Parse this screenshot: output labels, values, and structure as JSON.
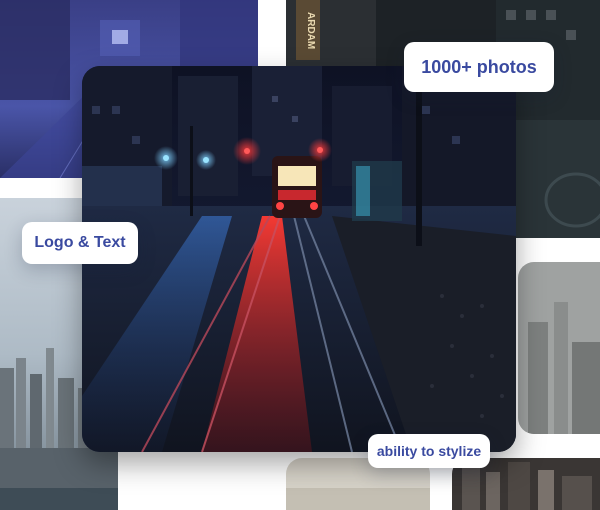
{
  "badges": {
    "photos": "1000+ photos",
    "logo_text": "Logo & Text",
    "stylize": "ability to stylize"
  },
  "sign_text": "ARDAM",
  "colors": {
    "badge_text": "#3a4aa0",
    "night_blue": "#2a3468",
    "tram_red": "#e0232a"
  }
}
